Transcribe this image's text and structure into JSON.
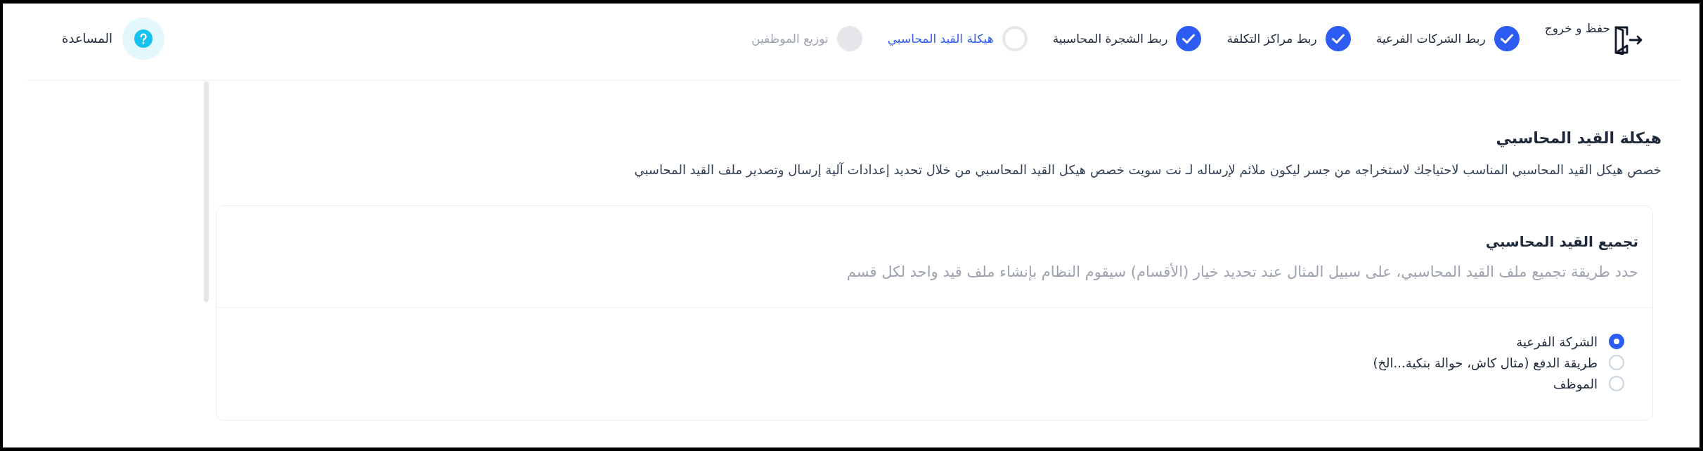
{
  "header": {
    "save_exit": {
      "label": "حفظ و خروج"
    },
    "steps": [
      {
        "label": "ربط الشركات الفرعية",
        "completed": true,
        "selected": false
      },
      {
        "label": "ربط مراكز التكلفة",
        "completed": true,
        "selected": false
      },
      {
        "label": "ربط الشجرة المحاسبية",
        "completed": true,
        "selected": false
      },
      {
        "label": "هيكلة القيد المحاسبي",
        "completed": false,
        "selected": true
      },
      {
        "label": "توزيع الموظفين",
        "completed": false,
        "selected": false
      }
    ],
    "help": {
      "label": "المساعدة"
    }
  },
  "page": {
    "title": "هيكلة القيد المحاسبي",
    "description": "خصص هيكل القيد المحاسبي المناسب لاحتياجك لاستخراجه من جسر ليكون ملائم لإرساله لـ نت سويت خصص هيكل القيد المحاسبي من خلال تحديد إعدادات آلية إرسال وتصدير ملف القيد المحاسبي"
  },
  "card": {
    "title": "تجميع القيد المحاسبي",
    "subtitle": "حدد طريقة تجميع ملف القيد المحاسبي، على سبيل المثال عند تحديد خيار (الأقسام) سيقوم النظام بإنشاء ملف قيد واحد لكل قسم",
    "options": [
      {
        "label": "الشركة الفرعية",
        "selected": true
      },
      {
        "label": "طريقة الدفع (مثال كاش، حوالة بنكية...الخ)",
        "selected": false
      },
      {
        "label": "الموظف",
        "selected": false
      }
    ]
  }
}
